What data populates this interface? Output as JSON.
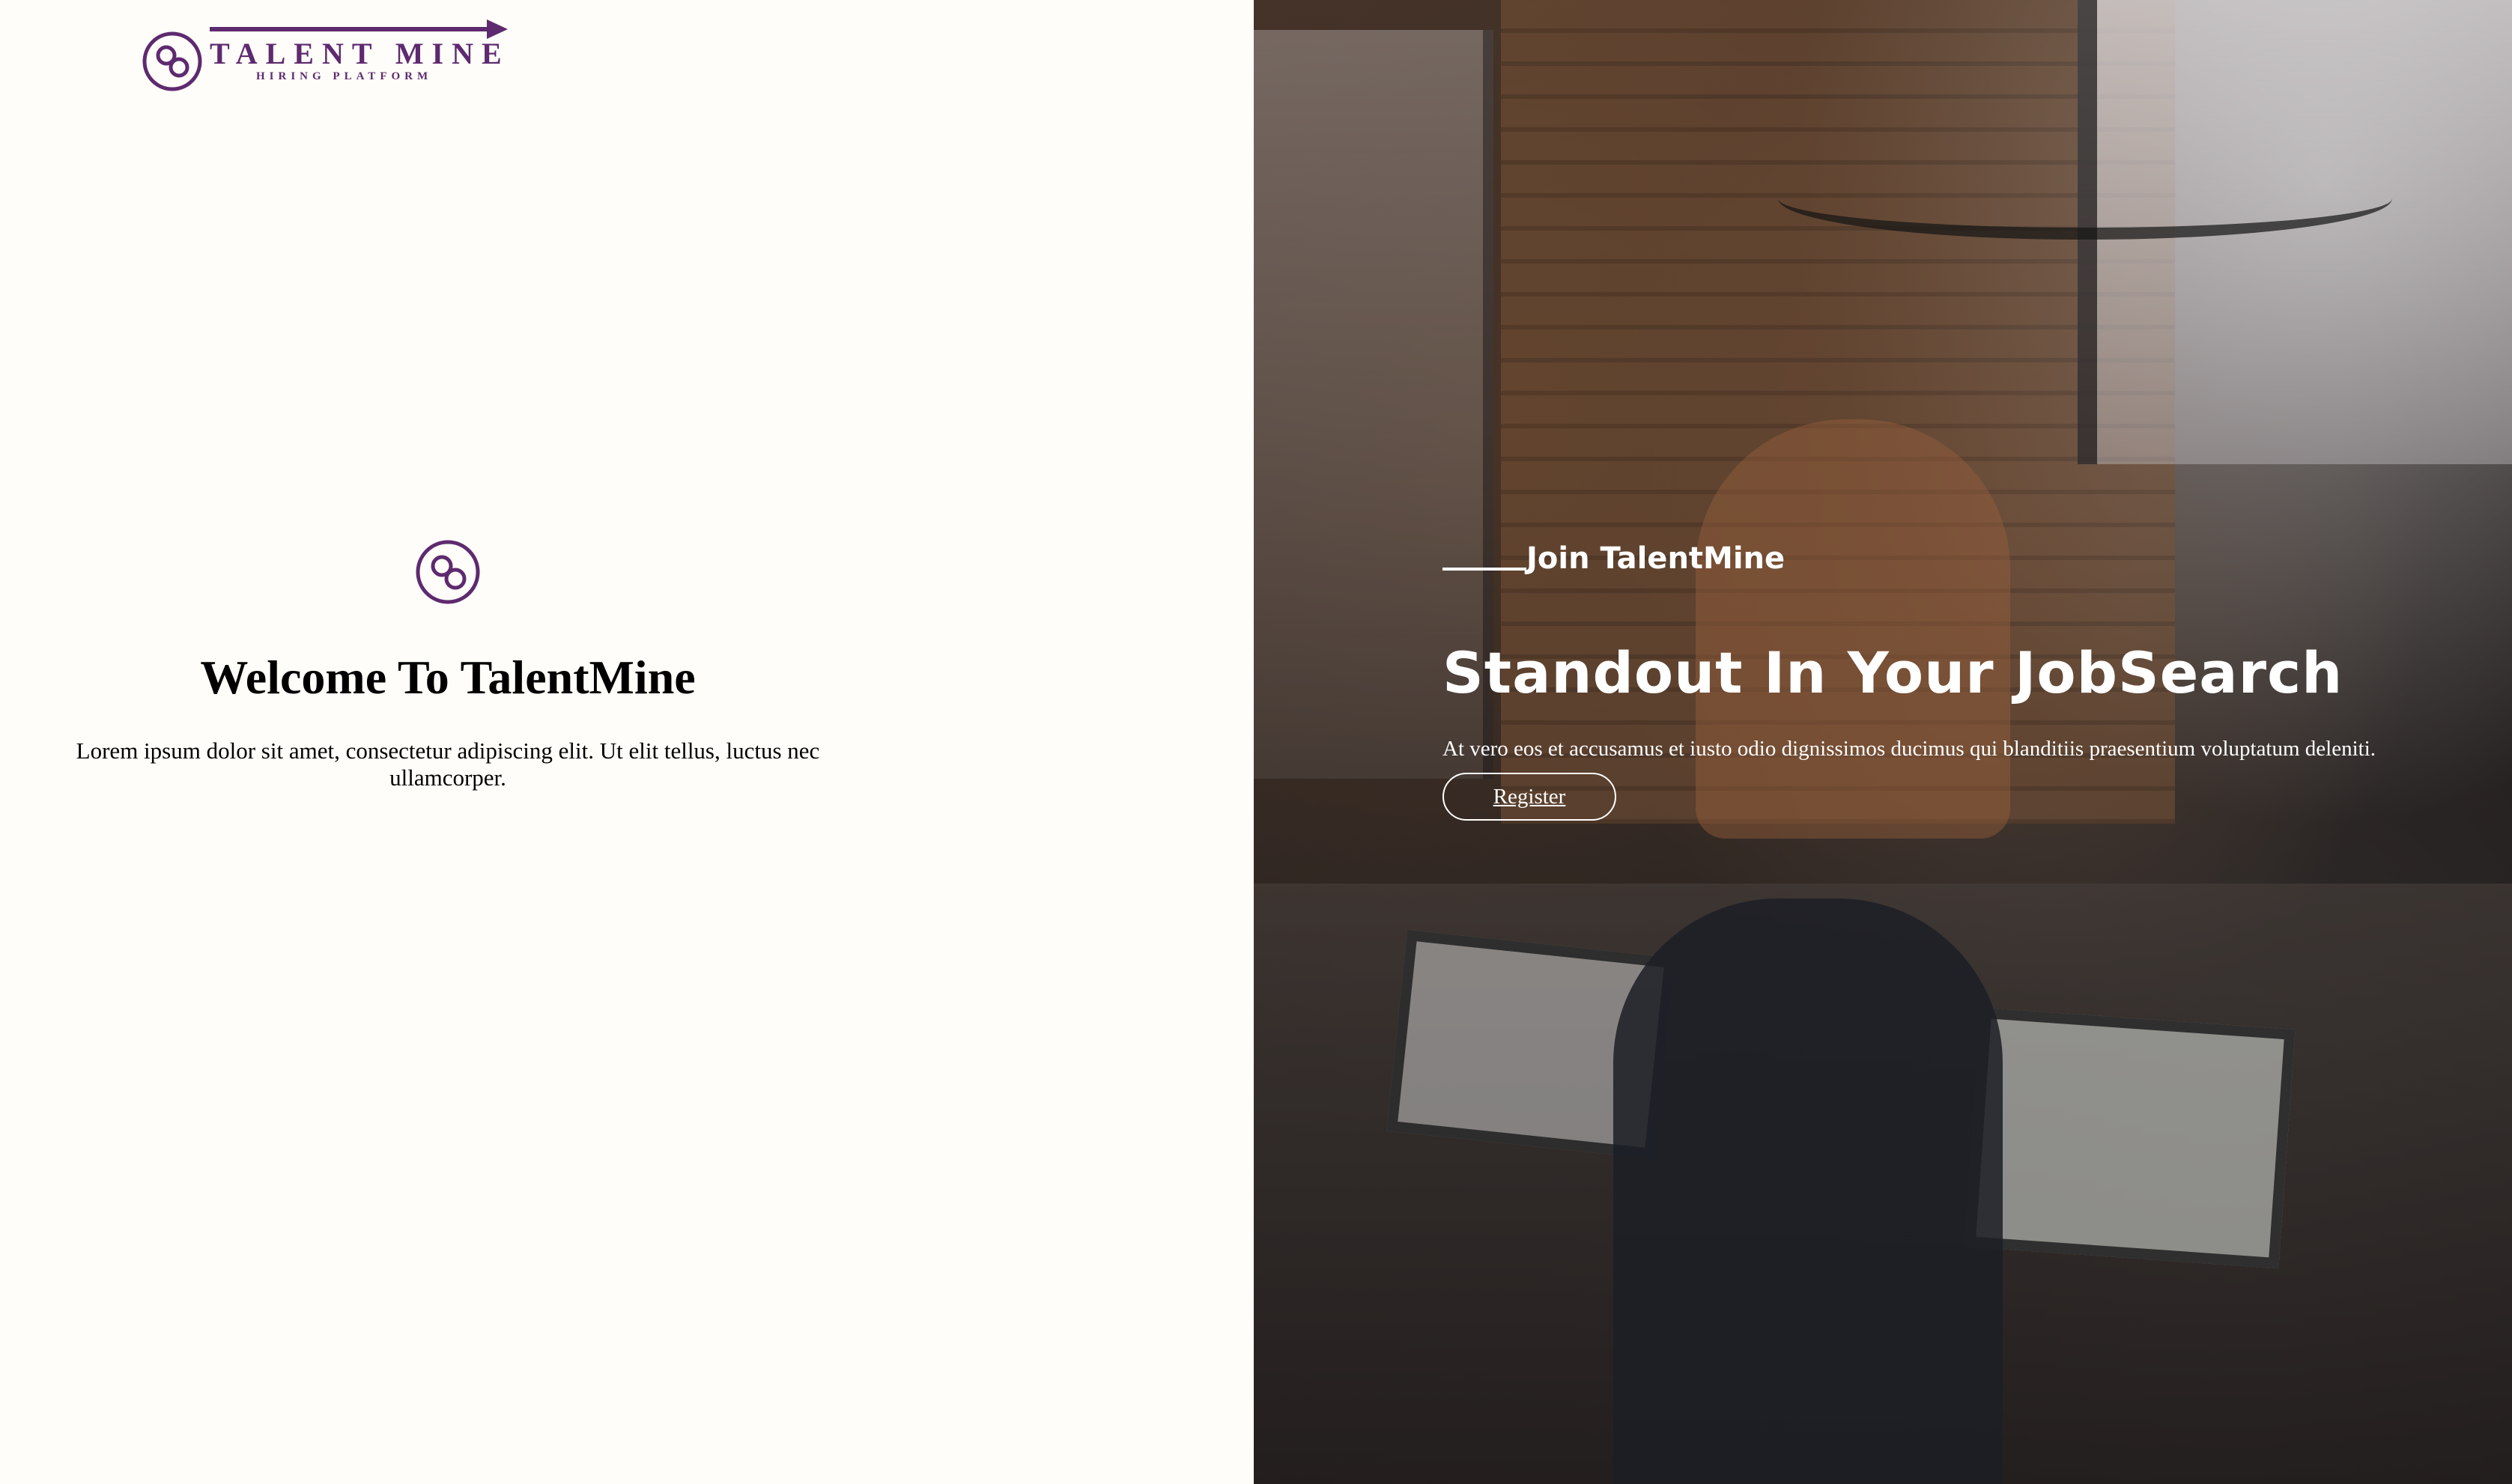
{
  "brand": {
    "name": "TALENT MINE",
    "tagline": "HIRING PLATFORM",
    "color": "#5e2a6f",
    "logo_icon": "infinity-circle-icon"
  },
  "left_panel": {
    "icon": "infinity-circle-icon",
    "title": "Welcome To TalentMine",
    "description": "Lorem ipsum dolor sit amet, consectetur adipiscing elit. Ut elit tellus, luctus nec ullamcorper."
  },
  "right_panel": {
    "eyebrow": "Join TalentMine",
    "headline": "Standout In Your JobSearch",
    "description": "At vero eos et accusamus et iusto odio dignissimos ducimus qui blanditiis praesentium voluptatum deleniti.",
    "register_label": "Register",
    "background": "team-working-on-laptops-photo"
  }
}
